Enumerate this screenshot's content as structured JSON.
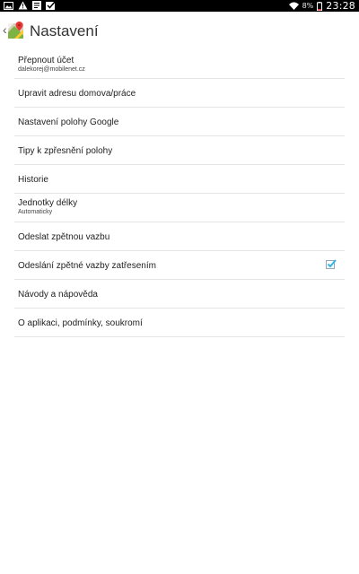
{
  "status_bar": {
    "icons_left": [
      "gallery-icon",
      "warning-icon",
      "card-icon",
      "check-icon"
    ],
    "battery_percent": "8%",
    "time": "23:28"
  },
  "action_bar": {
    "title": "Nastavení"
  },
  "settings": [
    {
      "label": "Přepnout účet",
      "sub": "dalekorej@mobilenet.cz"
    },
    {
      "label": "Upravit adresu domova/práce"
    },
    {
      "label": "Nastavení polohy Google"
    },
    {
      "label": "Tipy k zpřesnění polohy"
    },
    {
      "label": "Historie"
    },
    {
      "label": "Jednotky délky",
      "sub": "Automaticky"
    },
    {
      "label": "Odeslat zpětnou vazbu"
    },
    {
      "label": "Odeslání zpětné vazby zatřesením",
      "checked": true
    },
    {
      "label": "Návody a nápověda"
    },
    {
      "label": "O aplikaci, podmínky, soukromí"
    }
  ],
  "colors": {
    "accent": "#33b5e5",
    "divider": "#e4e4e4",
    "status_bar": "#000000"
  }
}
